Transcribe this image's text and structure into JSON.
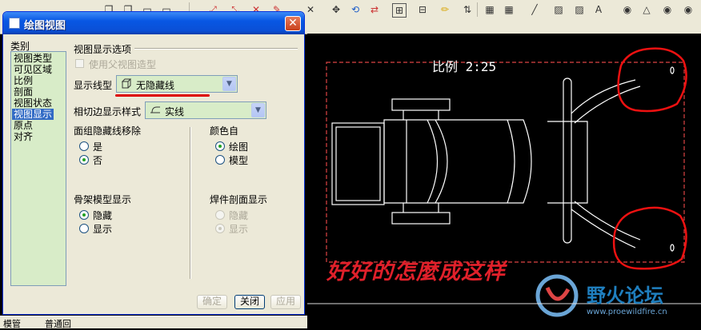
{
  "dialog": {
    "title": "绘图视图",
    "close_glyph": "✕",
    "category_label": "类别",
    "categories": [
      "视图类型",
      "可见区域",
      "比例",
      "剖面",
      "视图状态",
      "视图显示",
      "原点",
      "对齐"
    ],
    "selected_category": "视图显示",
    "section_title": "视图显示选项",
    "use_parent_style": "使用父视图造型",
    "display_style_label": "显示线型",
    "display_style_value": "无隐藏线",
    "tangent_label": "相切边显示样式",
    "tangent_value": "实线",
    "quilt_hidden_label": "面组隐藏线移除",
    "quilt_yes": "是",
    "quilt_no": "否",
    "color_from_label": "颜色自",
    "color_drawing": "绘图",
    "color_model": "模型",
    "skeleton_label": "骨架模型显示",
    "skeleton_hide": "隐藏",
    "skeleton_show": "显示",
    "weld_label": "焊件剖面显示",
    "weld_hide": "隐藏",
    "weld_show": "显示",
    "ok_button": "确定",
    "close_button": "关闭",
    "apply_button": "应用",
    "arrow_glyph": "▼"
  },
  "drawing": {
    "scale_text": "比例 2:25",
    "caption": "好好的怎麼成这样"
  },
  "watermark": {
    "name": "野火论坛",
    "url": "www.proewildfire.cn"
  },
  "status_strip": {
    "item1": "模管",
    "item2": "普通回"
  },
  "colors": {
    "title_blue": "#0a4fd6",
    "list_green": "#d8ecc8",
    "annotation_red": "#e0202a"
  }
}
